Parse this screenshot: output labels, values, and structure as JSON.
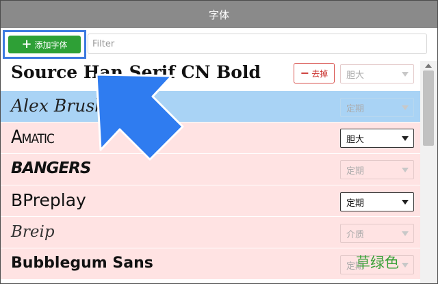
{
  "window": {
    "title": "字体"
  },
  "toolbar": {
    "add_label": "添加字体",
    "filter_placeholder": "Filter"
  },
  "rows": [
    {
      "name": "Source Han Serif CN Bold",
      "select": "胆大",
      "select_enabled": false,
      "bg": "#ffffff",
      "remove_label": "去掉"
    },
    {
      "name": "Alex Brush",
      "select": "定期",
      "select_enabled": false,
      "bg": "#a9d3f5"
    },
    {
      "name": "Amatic",
      "select": "胆大",
      "select_enabled": true,
      "bg": "#ffe3e3"
    },
    {
      "name": "Bangers",
      "select": "定期",
      "select_enabled": false,
      "bg": "#ffe3e3"
    },
    {
      "name": "BPreplay",
      "select": "定期",
      "select_enabled": true,
      "bg": "#ffe3e3"
    },
    {
      "name": "Breip",
      "select": "介质",
      "select_enabled": false,
      "bg": "#ffe3e3"
    },
    {
      "name": "Bubblegum Sans",
      "select": "定期",
      "select_enabled": false,
      "bg": "#ffe3e3"
    }
  ],
  "overlay": {
    "label": "草绿色"
  },
  "colors": {
    "accent_green": "#2ea036",
    "highlight_blue": "#3d7ae0",
    "selected_row": "#a9d3f5",
    "row_pink": "#ffe3e3"
  },
  "icons": {
    "add": "plus-icon",
    "remove": "minus-icon",
    "dropdown": "chevron-down-icon",
    "pointer": "arrow-pointer-icon"
  }
}
